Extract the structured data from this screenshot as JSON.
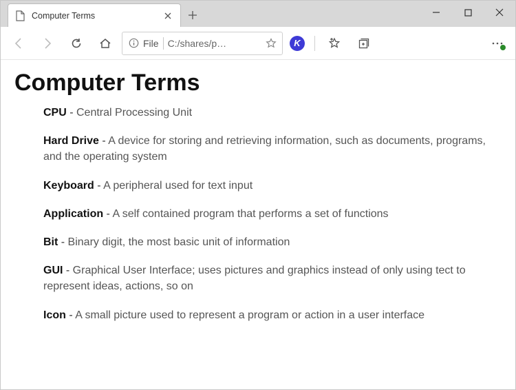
{
  "window": {
    "tab_title": "Computer Terms"
  },
  "toolbar": {
    "scheme": "File",
    "path": "C:/shares/p…",
    "k_label": "K"
  },
  "page": {
    "heading": "Computer Terms",
    "definitions": [
      {
        "term": "CPU",
        "desc": "Central Processing Unit"
      },
      {
        "term": "Hard Drive",
        "desc": "A device for storing and retrieving information, such as documents, programs, and the operating system"
      },
      {
        "term": "Keyboard",
        "desc": "A peripheral used for text input"
      },
      {
        "term": "Application",
        "desc": "A self contained program that performs a set of functions"
      },
      {
        "term": "Bit",
        "desc": "Binary digit, the most basic unit of information"
      },
      {
        "term": "GUI",
        "desc": "Graphical User Interface; uses pictures and graphics instead of only using tect to represent ideas, actions, so on"
      },
      {
        "term": "Icon",
        "desc": "A small picture used to represent a program or action in a user interface"
      }
    ]
  }
}
